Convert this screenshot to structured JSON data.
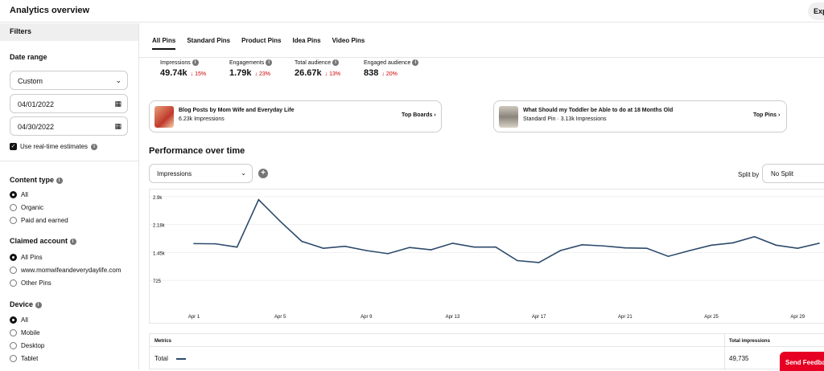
{
  "header": {
    "title": "Analytics overview",
    "export_label": "Exp"
  },
  "sidebar": {
    "filters_label": "Filters",
    "date_range": {
      "label": "Date range",
      "preset": "Custom",
      "start": "04/01/2022",
      "end": "04/30/2022",
      "realtime_label": "Use real-time estimates"
    },
    "content_type": {
      "label": "Content type",
      "options": [
        "All",
        "Organic",
        "Paid and earned"
      ],
      "selected": 0
    },
    "claimed_account": {
      "label": "Claimed account",
      "options": [
        "All Pins",
        "www.momwifeandeverydaylife.com",
        "Other Pins"
      ],
      "selected": 0
    },
    "device": {
      "label": "Device",
      "options": [
        "All",
        "Mobile",
        "Desktop",
        "Tablet"
      ],
      "selected": 0
    }
  },
  "tabs": [
    "All Pins",
    "Standard Pins",
    "Product Pins",
    "Idea Pins",
    "Video Pins"
  ],
  "active_tab": 0,
  "metrics": [
    {
      "label": "Impressions",
      "value": "49.74k",
      "change": "15%"
    },
    {
      "label": "Engagements",
      "value": "1.79k",
      "change": "23%"
    },
    {
      "label": "Total audience",
      "value": "26.67k",
      "change": "13%"
    },
    {
      "label": "Engaged audience",
      "value": "838",
      "change": "20%"
    }
  ],
  "top_cards": [
    {
      "title": "Blog Posts by Mom Wife and Everyday Life",
      "subtitle": "6.23k Impressions",
      "link": "Top Boards"
    },
    {
      "title": "What Should my Toddler be Able to do at 18 Months Old",
      "subtitle": "Standard Pin · 3.13k Impressions",
      "link": "Top Pins"
    }
  ],
  "performance": {
    "title": "Performance over time",
    "metric_select": "Impressions",
    "split_label": "Split by",
    "split_value": "No Split"
  },
  "chart_data": {
    "type": "line",
    "x": [
      "Apr 1",
      "Apr 2",
      "Apr 3",
      "Apr 4",
      "Apr 5",
      "Apr 6",
      "Apr 7",
      "Apr 8",
      "Apr 9",
      "Apr 10",
      "Apr 11",
      "Apr 12",
      "Apr 13",
      "Apr 14",
      "Apr 15",
      "Apr 16",
      "Apr 17",
      "Apr 18",
      "Apr 19",
      "Apr 20",
      "Apr 21",
      "Apr 22",
      "Apr 23",
      "Apr 24",
      "Apr 25",
      "Apr 26",
      "Apr 27",
      "Apr 28",
      "Apr 29",
      "Apr 30"
    ],
    "series": [
      {
        "name": "Total",
        "values": [
          1680,
          1675,
          1590,
          2820,
          2260,
          1740,
          1560,
          1610,
          1500,
          1420,
          1580,
          1520,
          1690,
          1590,
          1590,
          1240,
          1190,
          1500,
          1650,
          1620,
          1570,
          1560,
          1350,
          1500,
          1640,
          1700,
          1860,
          1640,
          1560,
          1690
        ],
        "color": "#2d4a6b"
      }
    ],
    "y_ticks": [
      "2.9k",
      "2.18k",
      "1.45k",
      "725"
    ],
    "x_ticks": [
      "Apr 1",
      "Apr 5",
      "Apr 9",
      "Apr 13",
      "Apr 17",
      "Apr 21",
      "Apr 25",
      "Apr 29"
    ],
    "ylim": [
      0,
      2900
    ]
  },
  "table": {
    "headers": {
      "metrics": "Metrics",
      "total_impressions": "Total impressions"
    },
    "row": {
      "name": "Total",
      "value": "49,735"
    }
  },
  "feedback_label": "Send Feedback"
}
